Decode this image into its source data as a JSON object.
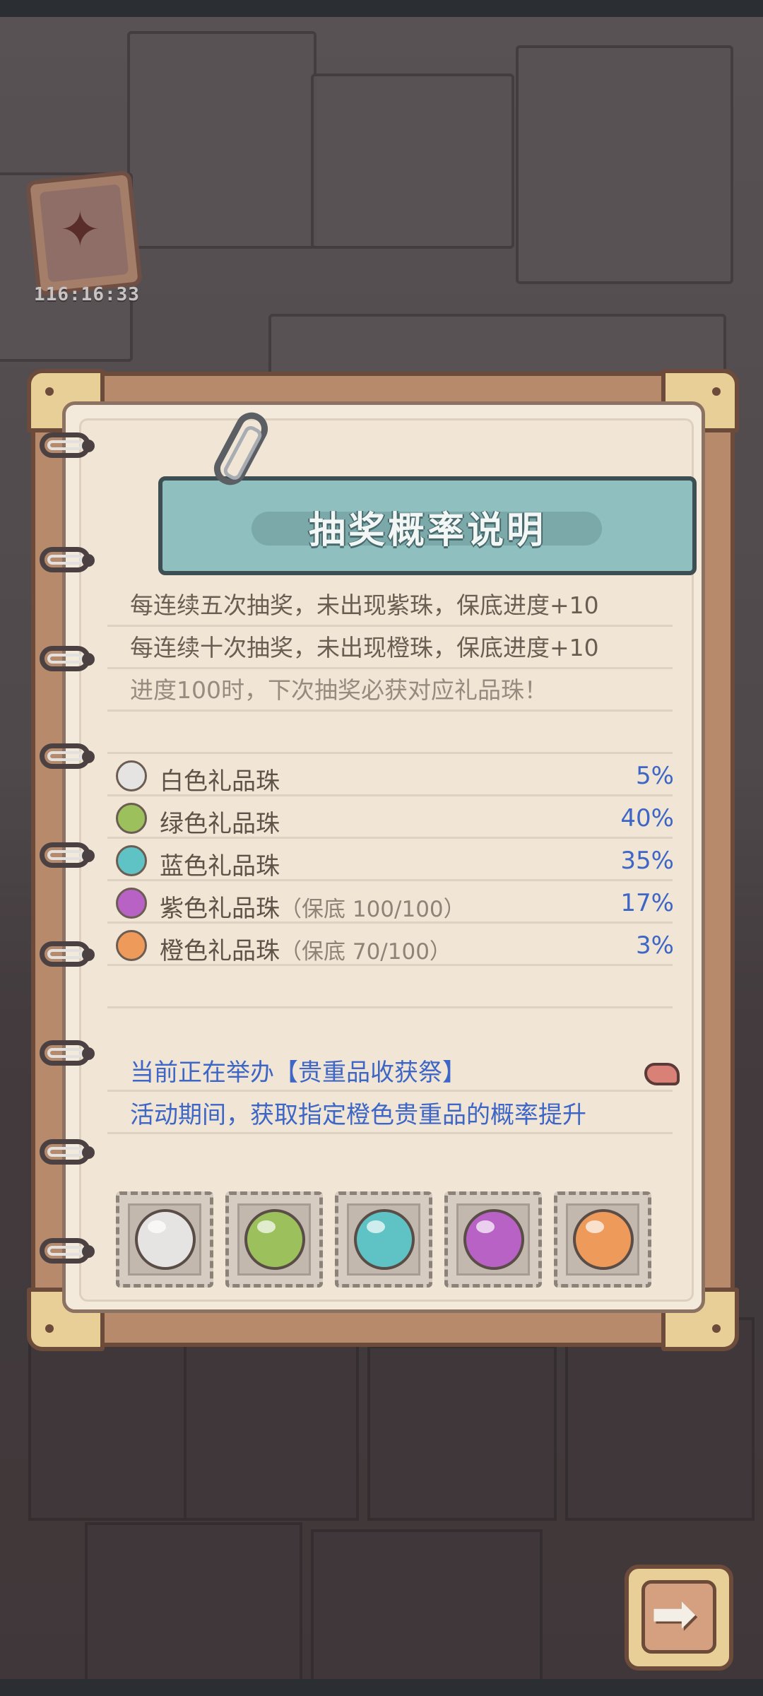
{
  "event_timer": "116:16:33",
  "panel": {
    "title": "抽奖概率说明",
    "notes": [
      "每连续五次抽奖，未出现紫珠，保底进度+10",
      "每连续十次抽奖，未出现橙珠，保底进度+10",
      "进度100时，下次抽奖必获对应礼品珠！"
    ],
    "rates": [
      {
        "name": "白色礼品珠",
        "extra": "",
        "percent": "5%",
        "color": "#e6e4e2"
      },
      {
        "name": "绿色礼品珠",
        "extra": "",
        "percent": "40%",
        "color": "#9cc05c"
      },
      {
        "name": "蓝色礼品珠",
        "extra": "",
        "percent": "35%",
        "color": "#5fc2c4"
      },
      {
        "name": "紫色礼品珠",
        "extra": "（保底  100/100）",
        "percent": "17%",
        "color": "#b962c6"
      },
      {
        "name": "橙色礼品珠",
        "extra": "（保底  70/100）",
        "percent": "3%",
        "color": "#ee9a5a"
      }
    ],
    "event": {
      "line1": "当前正在举办【贵重品收获祭】",
      "line2": "活动期间，获取指定橙色贵重品的概率提升"
    },
    "gems": [
      "white-gem-icon",
      "green-gem-icon",
      "blue-gem-icon",
      "purple-gem-icon",
      "orange-gem-icon"
    ]
  },
  "icons": {
    "event_card": "radish-card-icon",
    "event_share": "share-arrow-icon",
    "next": "right-arrow-icon"
  },
  "colors": {
    "accent_text": "#3d66c6",
    "banner": "#8fc0bf",
    "paper": "#f4eadb"
  }
}
